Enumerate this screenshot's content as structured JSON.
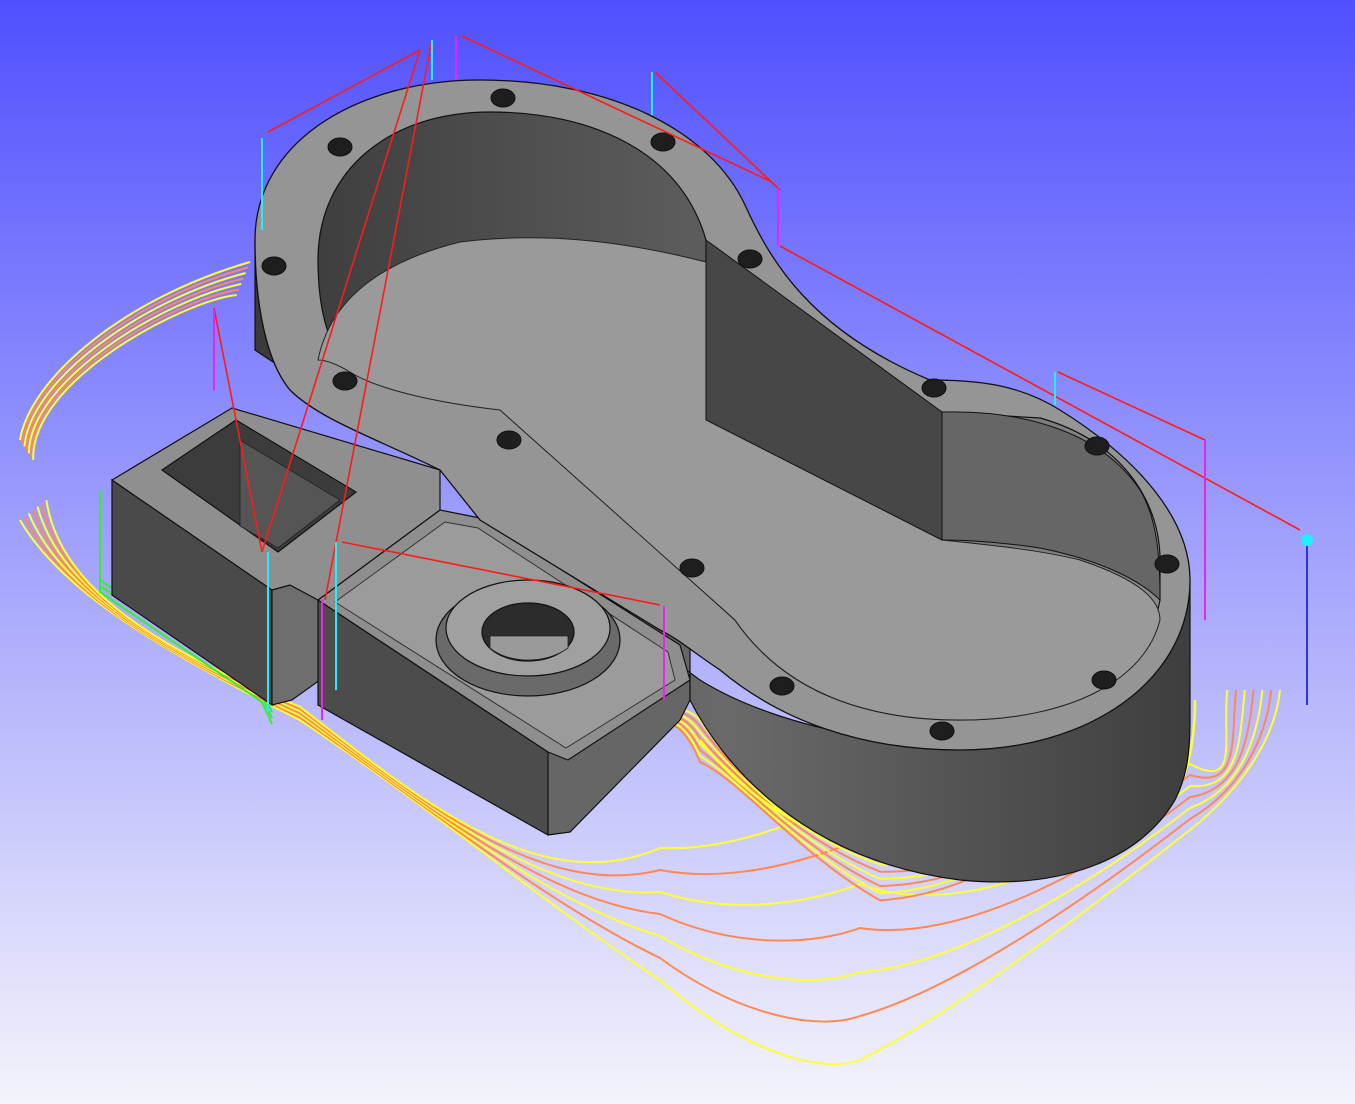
{
  "viewport": {
    "background_top": "#5050ff",
    "background_bottom": "#f4f4fb"
  },
  "colors": {
    "part_top": "#959595",
    "part_wall_light": "#7e7e7e",
    "part_wall_dark": "#454545",
    "part_inner_wall": "#626262",
    "part_floor": "#9a9a9a",
    "part_edge": "#111111",
    "toolpath_cut": "#ffff33",
    "toolpath_cut_alt": "#ff8855",
    "toolpath_finish": "#33ee33",
    "rapid": "#ff1a1a",
    "plunge": "#22eeff",
    "retract": "#ee22ee",
    "lead": "#3333dd",
    "tool_marker": "#22eeff"
  },
  "toolpath_passes": {
    "outer_rough_count": 7,
    "pad_rough_count": 8,
    "finish_count": 3
  }
}
